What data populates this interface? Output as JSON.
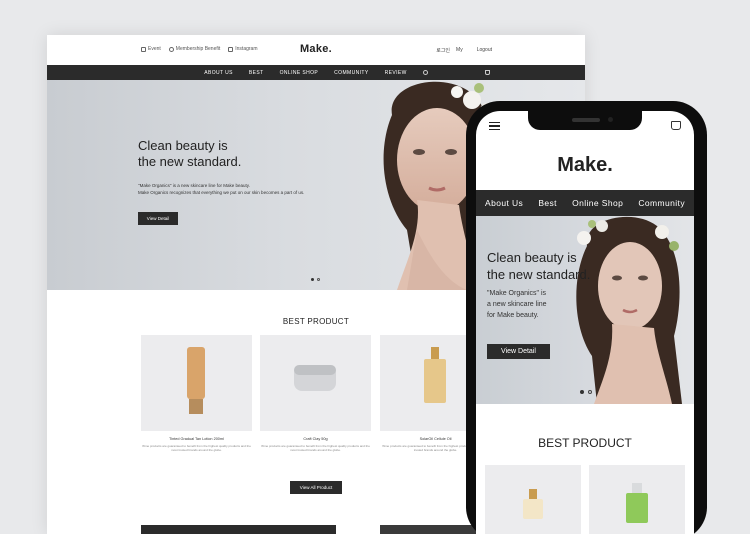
{
  "desktop": {
    "toplinks": [
      "Event",
      "Membership Benefit",
      "Instagram"
    ],
    "logo": "Make.",
    "userlinks": [
      "로그인",
      "My",
      "Logout"
    ],
    "nav": [
      "ABOUT US",
      "BEST",
      "ONLINE SHOP",
      "COMMUNITY",
      "REVIEW"
    ],
    "hero": {
      "title": "Clean beauty is\nthe new standard.",
      "desc": "\"Make Organics\" is a new skincare line for Make beauty.\nMake Organics recognizes that everything we put on our skin becomes a part of us.",
      "button": "View Detail"
    },
    "best_title": "BEST PRODUCT",
    "products": [
      {
        "name": "Tinted Gradual Tan Lotion 200ml",
        "desc": "Wme products are guaranteed to benefit from the highest quality\nproducts and the most trusted brands around the globe."
      },
      {
        "name": "Craft Clay 50g",
        "desc": "Wme products are guaranteed to benefit from the highest quality\nproducts and the most trusted brands around the globe."
      },
      {
        "name": "SolarOil Cellule Oil",
        "desc": "Wme products are guaranteed to benefit from the highest\nproducts and the most trusted brands around the globe."
      }
    ],
    "view_all": "View All Product"
  },
  "mobile": {
    "logo": "Make.",
    "nav": [
      "About Us",
      "Best",
      "Online Shop",
      "Community"
    ],
    "hero": {
      "title": "Clean beauty is\nthe new standard.",
      "desc": "\"Make Organics\" is\na new skincare line\nfor Make beauty.",
      "button": "View Detail"
    },
    "best_title": "BEST PRODUCT"
  },
  "colors": {
    "dark": "#2b2b2b",
    "background": "#e8e9eb",
    "hero": "#d5d8dc",
    "card": "#ececee"
  }
}
